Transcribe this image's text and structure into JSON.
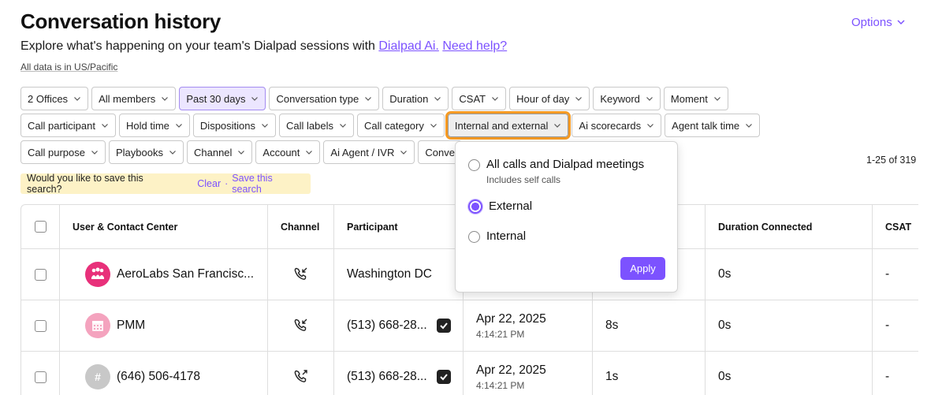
{
  "header": {
    "title": "Conversation history",
    "options_label": "Options",
    "subtitle_text": "Explore what's happening on your team's Dialpad sessions with",
    "dialpad_ai_link": "Dialpad Ai.",
    "help_link": "Need help?",
    "timezone_note": "All data is in US/Pacific"
  },
  "filters": {
    "row1": [
      "2 Offices",
      "All members",
      "Past 30 days",
      "Conversation type",
      "Duration",
      "CSAT",
      "Hour of day",
      "Keyword",
      "Moment"
    ],
    "row2": [
      "Call participant",
      "Hold time",
      "Dispositions",
      "Call labels",
      "Call category",
      "Internal and external",
      "Ai scorecards",
      "Agent talk time"
    ],
    "row3": [
      "Call purpose",
      "Playbooks",
      "Channel",
      "Account",
      "Ai Agent / IVR",
      "Conve"
    ]
  },
  "save_banner": {
    "question": "Would you like to save this search?",
    "clear": "Clear",
    "separator": "·",
    "save": "Save this search"
  },
  "pagination": {
    "range": "1-25 of 319"
  },
  "table": {
    "headers": {
      "user": "User & Contact Center",
      "channel": "Channel",
      "participant": "Participant",
      "duration_connected": "Duration Connected",
      "csat": "CSAT"
    },
    "rows": [
      {
        "user": "AeroLabs San Francisc...",
        "avatar": "team-avatar",
        "channel": "incoming-call-icon",
        "participant": "Washington DC",
        "date": "",
        "time": "",
        "duration": "",
        "duration_connected": "0s",
        "csat": "-"
      },
      {
        "user": "PMM",
        "avatar": "calendar-avatar",
        "channel": "incoming-call-icon",
        "participant": "(513) 668-28...",
        "date": "Apr 22, 2025",
        "time": "4:14:21 PM",
        "duration": "8s",
        "duration_connected": "0s",
        "csat": "-"
      },
      {
        "user": "(646) 506-4178",
        "avatar": "#",
        "channel": "outgoing-call-icon",
        "participant": "(513) 668-28...",
        "date": "Apr 22, 2025",
        "time": "4:14:21 PM",
        "duration": "1s",
        "duration_connected": "0s",
        "csat": "-"
      }
    ]
  },
  "dropdown": {
    "options": [
      {
        "label": "All calls and Dialpad meetings",
        "sub": "Includes self calls",
        "checked": false
      },
      {
        "label": "External",
        "sub": "",
        "checked": true
      },
      {
        "label": "Internal",
        "sub": "",
        "checked": false
      }
    ],
    "apply_label": "Apply"
  },
  "colors": {
    "accent": "#7c52ff",
    "highlight": "#f59a23",
    "banner": "#fdf2c6"
  }
}
